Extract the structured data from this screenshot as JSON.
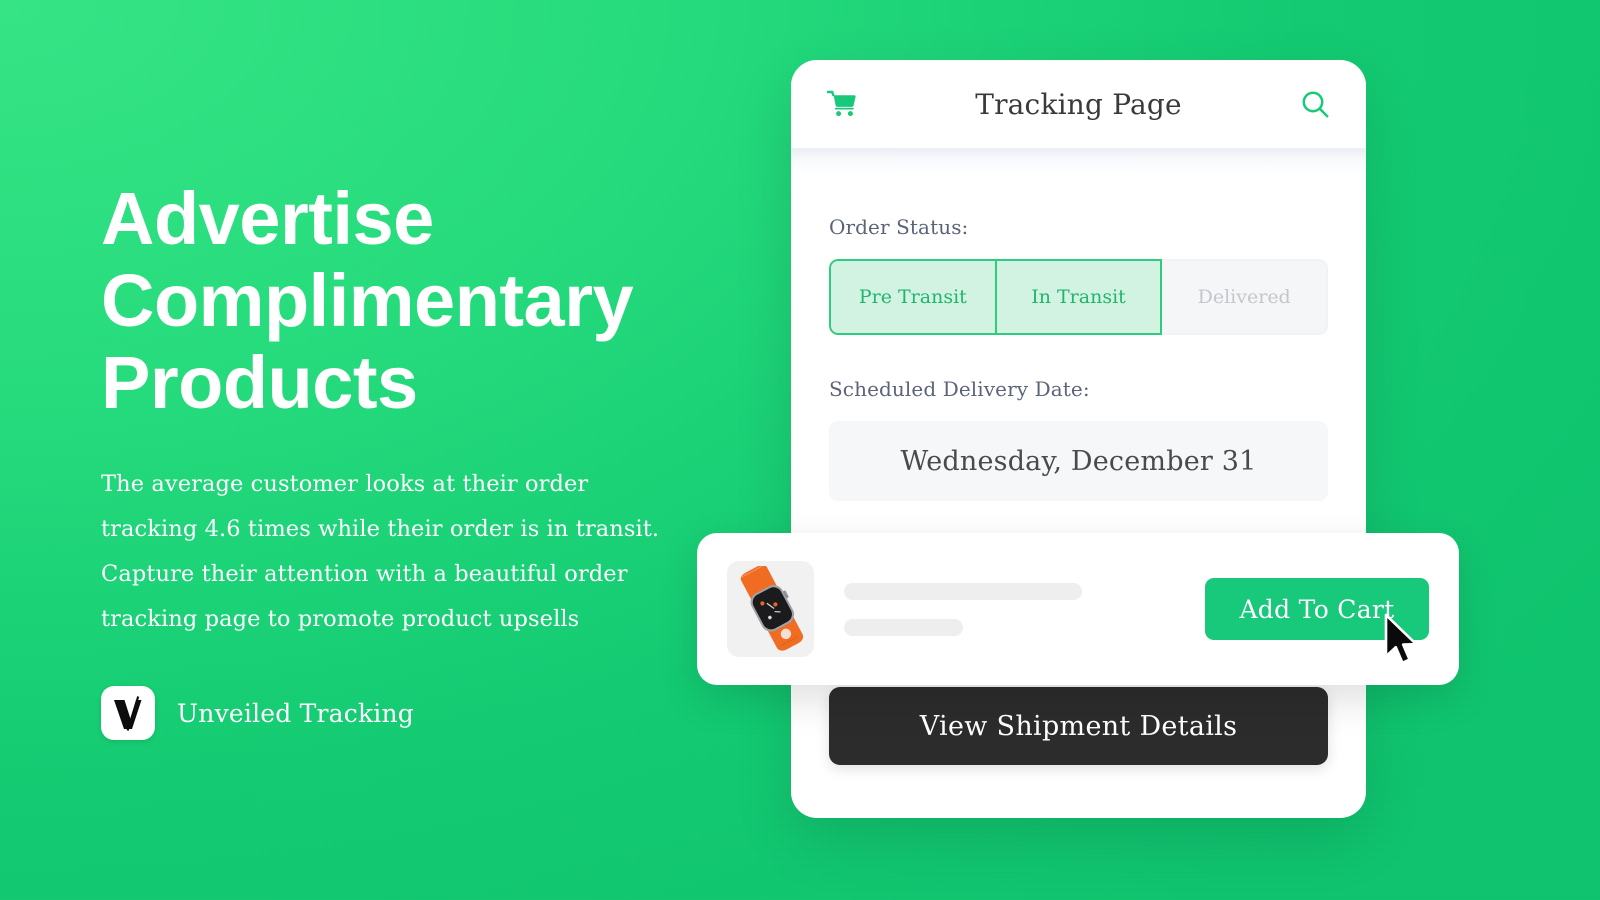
{
  "theme": {
    "brand_green": "#18c97c",
    "bg_green_light": "#35e585",
    "bg_green_dark": "#0ec46e",
    "dark_button": "#2c2c2c",
    "segment_fill": "#d2f3e1",
    "segment_border": "#2ecb80",
    "label_color": "#5b6478"
  },
  "hero": {
    "headline": "Advertise Complimentary Products",
    "body": "The average customer looks at their order tracking 4.6 times while their order is in transit. Capture their attention with a beautiful order tracking page to promote product upsells",
    "brand_name": "Unveiled Tracking",
    "logo_icon": "unveiled-v-logo-icon"
  },
  "phone": {
    "header": {
      "cart_icon": "shopping-cart-icon",
      "title": "Tracking Page",
      "search_icon": "search-icon"
    },
    "order_status": {
      "label": "Order Status:",
      "segments": [
        {
          "label": "Pre Transit",
          "state": "active"
        },
        {
          "label": "In Transit",
          "state": "active"
        },
        {
          "label": "Delivered",
          "state": "inactive"
        }
      ]
    },
    "delivery": {
      "label": "Scheduled Delivery Date:",
      "value": "Wednesday, December 31"
    },
    "cta": {
      "label": "View Shipment Details"
    }
  },
  "upsell": {
    "product_image_alt": "orange-smartwatch-thumbnail",
    "title_placeholder": "",
    "subtitle_placeholder": "",
    "add_to_cart_label": "Add To Cart",
    "cursor_icon": "mouse-pointer-icon"
  }
}
